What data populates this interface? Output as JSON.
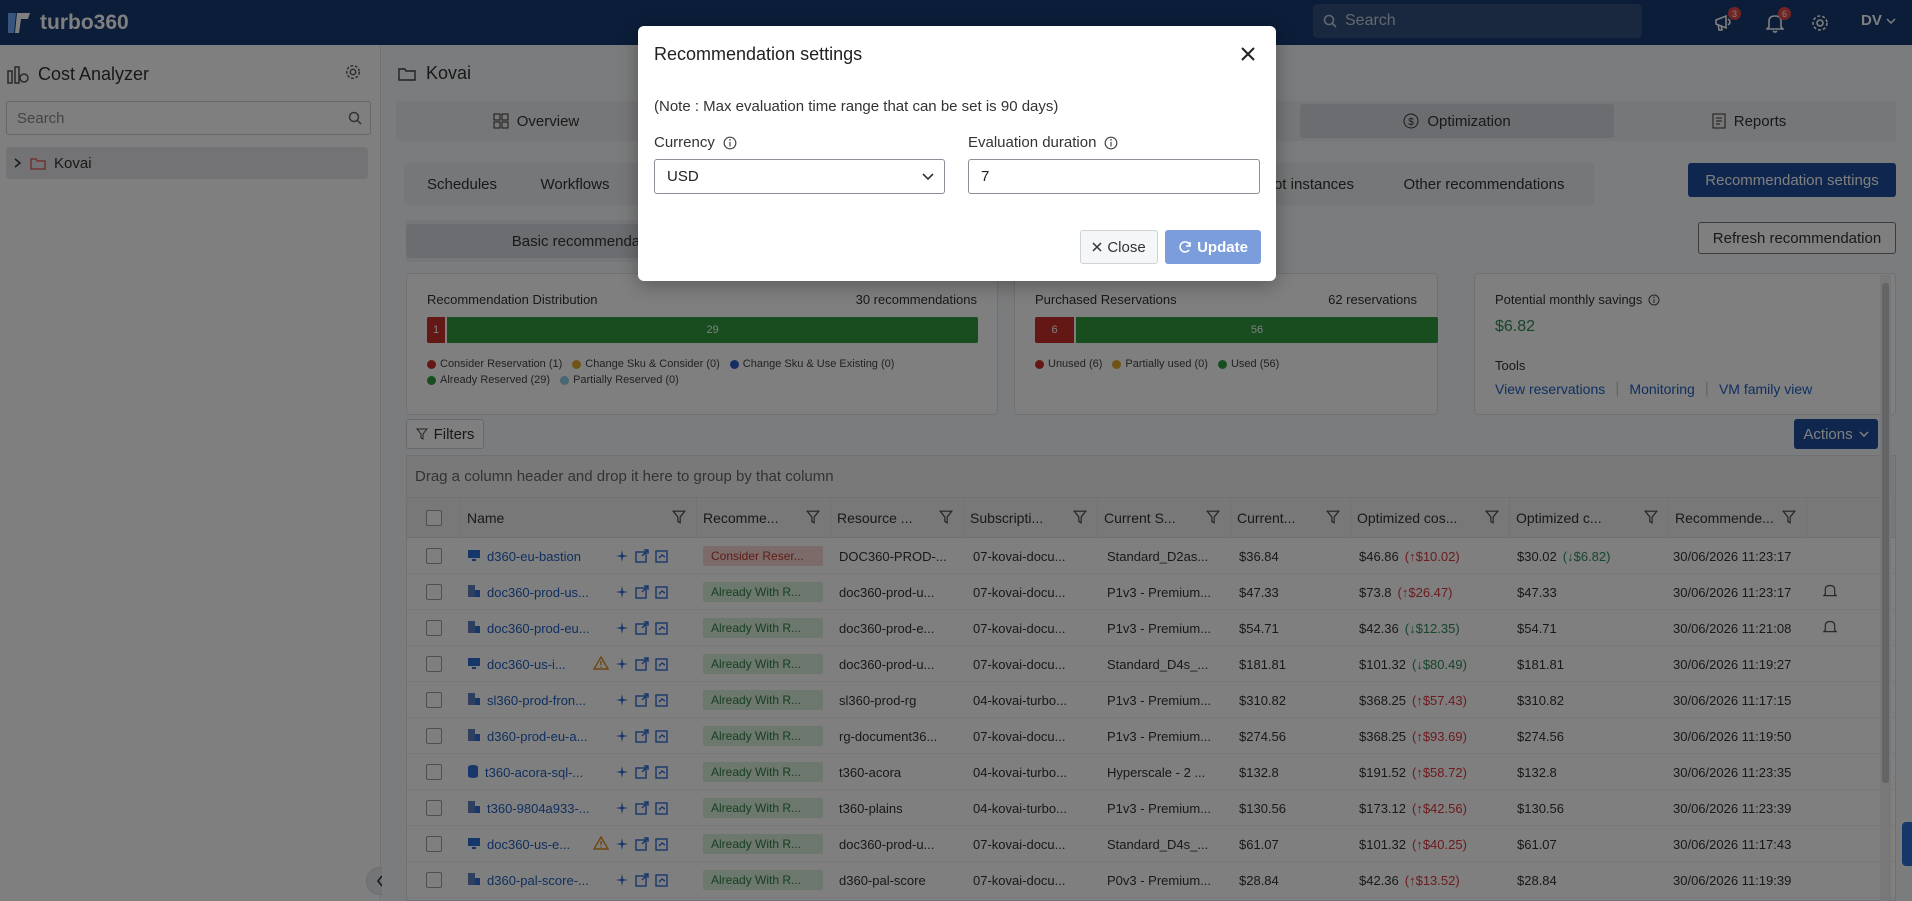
{
  "app": {
    "brand": "turbo360",
    "search_placeholder": "Search",
    "notifications_count_1": "3",
    "notifications_count_2": "6",
    "user_initials": "DV"
  },
  "sidebar": {
    "title": "Cost Analyzer",
    "search_placeholder": "Search",
    "tree_item": "Kovai"
  },
  "main": {
    "breadcrumb": "Kovai",
    "top_tabs": [
      "Overview",
      "Optimization",
      "Reports"
    ],
    "sub_tabs": [
      "Schedules",
      "Workflows",
      "ot instances",
      "Other recommendations"
    ],
    "recommendation_settings_button": "Recommendation settings",
    "basic_recommendations_tab": "Basic recommendatio",
    "refresh_button": "Refresh recommendation",
    "filters_button": "Filters",
    "actions_button": "Actions"
  },
  "cards": {
    "distribution": {
      "title": "Recommendation Distribution",
      "count": "30 recommendations",
      "bar_fractions": [
        0.033,
        0.967
      ],
      "bar_labels": [
        "1",
        "29"
      ],
      "legend": [
        {
          "label": "Consider Reservation (1)",
          "color": "#c9302c"
        },
        {
          "label": "Change Sku & Consider (0)",
          "color": "#e0a82e"
        },
        {
          "label": "Change Sku & Use Existing (0)",
          "color": "#2e5bc9"
        },
        {
          "label": "Already Reserved (29)",
          "color": "#2e9a3e"
        },
        {
          "label": "Partially Reserved (0)",
          "color": "#8fd0e6"
        }
      ]
    },
    "reservations": {
      "title": "Purchased Reservations",
      "count": "62 reservations",
      "bar_fractions": [
        0.097,
        0.903
      ],
      "bar_labels": [
        "6",
        "56"
      ],
      "legend": [
        {
          "label": "Unused (6)",
          "color": "#c9302c"
        },
        {
          "label": "Partially used (0)",
          "color": "#e0a82e"
        },
        {
          "label": "Used (56)",
          "color": "#2e9a3e"
        }
      ]
    },
    "savings": {
      "title": "Potential monthly savings",
      "value": "$6.82",
      "tools_label": "Tools",
      "links": [
        "View reservations",
        "Monitoring",
        "VM family view"
      ]
    }
  },
  "grid": {
    "group_hint": "Drag a column header and drop it here to group by that column",
    "columns": [
      "Name",
      "Recomme...",
      "Resource ...",
      "Subscripti...",
      "Current S...",
      "Current...",
      "Optimized cos...",
      "Optimized c...",
      "Recommende..."
    ],
    "rows": [
      {
        "name": "d360-eu-bastion",
        "icon": "vm",
        "warn": false,
        "rec": "Consider Reser...",
        "rec_type": "consider",
        "rg": "DOC360-PROD-...",
        "sub": "07-kovai-docu...",
        "sku": "Standard_D2as...",
        "cur": "$36.84",
        "opt": "$46.86",
        "opt_delta": "(↑$10.02)",
        "opt_dir": "up",
        "optc": "$30.02",
        "optc_delta": "(↓$6.82)",
        "optc_dir": "down",
        "date": "30/06/2026 11:23:17",
        "bell": false
      },
      {
        "name": "doc360-prod-us...",
        "icon": "app",
        "warn": false,
        "rec": "Already With R...",
        "rec_type": "already",
        "rg": "doc360-prod-u...",
        "sub": "07-kovai-docu...",
        "sku": "P1v3 - Premium...",
        "cur": "$47.33",
        "opt": "$73.8",
        "opt_delta": "(↑$26.47)",
        "opt_dir": "up",
        "optc": "$47.33",
        "optc_delta": "",
        "optc_dir": "",
        "date": "30/06/2026 11:23:17",
        "bell": true
      },
      {
        "name": "doc360-prod-eu...",
        "icon": "app",
        "warn": false,
        "rec": "Already With R...",
        "rec_type": "already",
        "rg": "doc360-prod-e...",
        "sub": "07-kovai-docu...",
        "sku": "P1v3 - Premium...",
        "cur": "$54.71",
        "opt": "$42.36",
        "opt_delta": "(↓$12.35)",
        "opt_dir": "down",
        "optc": "$54.71",
        "optc_delta": "",
        "optc_dir": "",
        "date": "30/06/2026 11:21:08",
        "bell": true
      },
      {
        "name": "doc360-us-i...",
        "icon": "vm",
        "warn": true,
        "rec": "Already With R...",
        "rec_type": "already",
        "rg": "doc360-prod-u...",
        "sub": "07-kovai-docu...",
        "sku": "Standard_D4s_...",
        "cur": "$181.81",
        "opt": "$101.32",
        "opt_delta": "(↓$80.49)",
        "opt_dir": "down",
        "optc": "$181.81",
        "optc_delta": "",
        "optc_dir": "",
        "date": "30/06/2026 11:19:27",
        "bell": false
      },
      {
        "name": "sl360-prod-fron...",
        "icon": "app",
        "warn": false,
        "rec": "Already With R...",
        "rec_type": "already",
        "rg": "sl360-prod-rg",
        "sub": "04-kovai-turbo...",
        "sku": "P1v3 - Premium...",
        "cur": "$310.82",
        "opt": "$368.25",
        "opt_delta": "(↑$57.43)",
        "opt_dir": "up",
        "optc": "$310.82",
        "optc_delta": "",
        "optc_dir": "",
        "date": "30/06/2026 11:17:15",
        "bell": false
      },
      {
        "name": "d360-prod-eu-a...",
        "icon": "app",
        "warn": false,
        "rec": "Already With R...",
        "rec_type": "already",
        "rg": "rg-document36...",
        "sub": "07-kovai-docu...",
        "sku": "P1v3 - Premium...",
        "cur": "$274.56",
        "opt": "$368.25",
        "opt_delta": "(↑$93.69)",
        "opt_dir": "up",
        "optc": "$274.56",
        "optc_delta": "",
        "optc_dir": "",
        "date": "30/06/2026 11:19:50",
        "bell": false
      },
      {
        "name": "t360-acora-sql-...",
        "icon": "sql",
        "warn": false,
        "rec": "Already With R...",
        "rec_type": "already",
        "rg": "t360-acora",
        "sub": "04-kovai-turbo...",
        "sku": "Hyperscale - 2 ...",
        "cur": "$132.8",
        "opt": "$191.52",
        "opt_delta": "(↑$58.72)",
        "opt_dir": "up",
        "optc": "$132.8",
        "optc_delta": "",
        "optc_dir": "",
        "date": "30/06/2026 11:23:35",
        "bell": false
      },
      {
        "name": "t360-9804a933-...",
        "icon": "app",
        "warn": false,
        "rec": "Already With R...",
        "rec_type": "already",
        "rg": "t360-plains",
        "sub": "04-kovai-turbo...",
        "sku": "P1v3 - Premium...",
        "cur": "$130.56",
        "opt": "$173.12",
        "opt_delta": "(↑$42.56)",
        "opt_dir": "up",
        "optc": "$130.56",
        "optc_delta": "",
        "optc_dir": "",
        "date": "30/06/2026 11:23:39",
        "bell": false
      },
      {
        "name": "doc360-us-e...",
        "icon": "vm",
        "warn": true,
        "rec": "Already With R...",
        "rec_type": "already",
        "rg": "doc360-prod-u...",
        "sub": "07-kovai-docu...",
        "sku": "Standard_D4s_...",
        "cur": "$61.07",
        "opt": "$101.32",
        "opt_delta": "(↑$40.25)",
        "opt_dir": "up",
        "optc": "$61.07",
        "optc_delta": "",
        "optc_dir": "",
        "date": "30/06/2026 11:17:43",
        "bell": false
      },
      {
        "name": "d360-pal-score-...",
        "icon": "app",
        "warn": false,
        "rec": "Already With R...",
        "rec_type": "already",
        "rg": "d360-pal-score",
        "sub": "07-kovai-docu...",
        "sku": "P0v3 - Premium...",
        "cur": "$28.84",
        "opt": "$42.36",
        "opt_delta": "(↑$13.52)",
        "opt_dir": "up",
        "optc": "$28.84",
        "optc_delta": "",
        "optc_dir": "",
        "date": "30/06/2026 11:19:39",
        "bell": false
      }
    ]
  },
  "modal": {
    "title": "Recommendation settings",
    "note": "(Note : Max evaluation time range that can be set is 90 days)",
    "currency_label": "Currency",
    "currency_value": "USD",
    "duration_label": "Evaluation duration",
    "duration_value": "7",
    "close_button": "Close",
    "update_button": "Update"
  }
}
